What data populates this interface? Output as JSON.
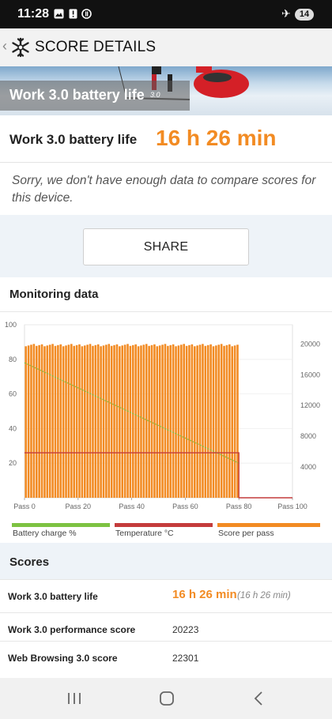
{
  "status_bar": {
    "time": "11:28",
    "notification_count": "14"
  },
  "app_bar": {
    "title": "SCORE DETAILS"
  },
  "banner": {
    "title": "Work 3.0 battery life",
    "version": "3.0"
  },
  "result": {
    "label": "Work 3.0 battery life",
    "value": "16 h 26 min"
  },
  "message": "Sorry, we don't have enough data to compare scores for this device.",
  "share_label": "SHARE",
  "monitoring": {
    "heading": "Monitoring data",
    "legend": [
      "Battery charge %",
      "Temperature °C",
      "Score per pass"
    ],
    "colors": {
      "battery": "#7dc242",
      "temperature": "#c43c3c",
      "score": "#f28b23"
    }
  },
  "chart_data": {
    "type": "bar",
    "x_ticks": [
      "Pass 0",
      "Pass 20",
      "Pass 40",
      "Pass 60",
      "Pass 80",
      "Pass 100"
    ],
    "x_range": [
      0,
      100
    ],
    "y_left_ticks": [
      "20",
      "40",
      "60",
      "80",
      "100"
    ],
    "y_left_range": [
      0,
      100
    ],
    "y_right_ticks": [
      "4000",
      "8000",
      "12000",
      "16000",
      "20000"
    ],
    "y_right_range": [
      0,
      22500
    ],
    "series": [
      {
        "name": "Score per pass",
        "axis": "right",
        "passes": 80,
        "approx_value": 20000
      },
      {
        "name": "Battery charge %",
        "axis": "left",
        "x": [
          0,
          80
        ],
        "y": [
          78,
          20
        ]
      },
      {
        "name": "Temperature °C",
        "axis": "left",
        "x": [
          0,
          80,
          80,
          100
        ],
        "y": [
          26,
          26,
          0,
          0
        ]
      }
    ]
  },
  "scores": {
    "heading": "Scores",
    "rows": [
      {
        "label": "Work 3.0 battery life",
        "value": "16 h 26 min",
        "sub": "(16 h 26 min)"
      },
      {
        "label": "Work 3.0 performance score",
        "value": "20223"
      },
      {
        "label": "Web Browsing 3.0 score",
        "value": "22301"
      }
    ]
  },
  "icons": [
    "image-icon",
    "alert-icon",
    "sync-icon",
    "airplane-icon",
    "snowflake-logo-icon",
    "recents-icon",
    "home-icon",
    "back-icon"
  ]
}
